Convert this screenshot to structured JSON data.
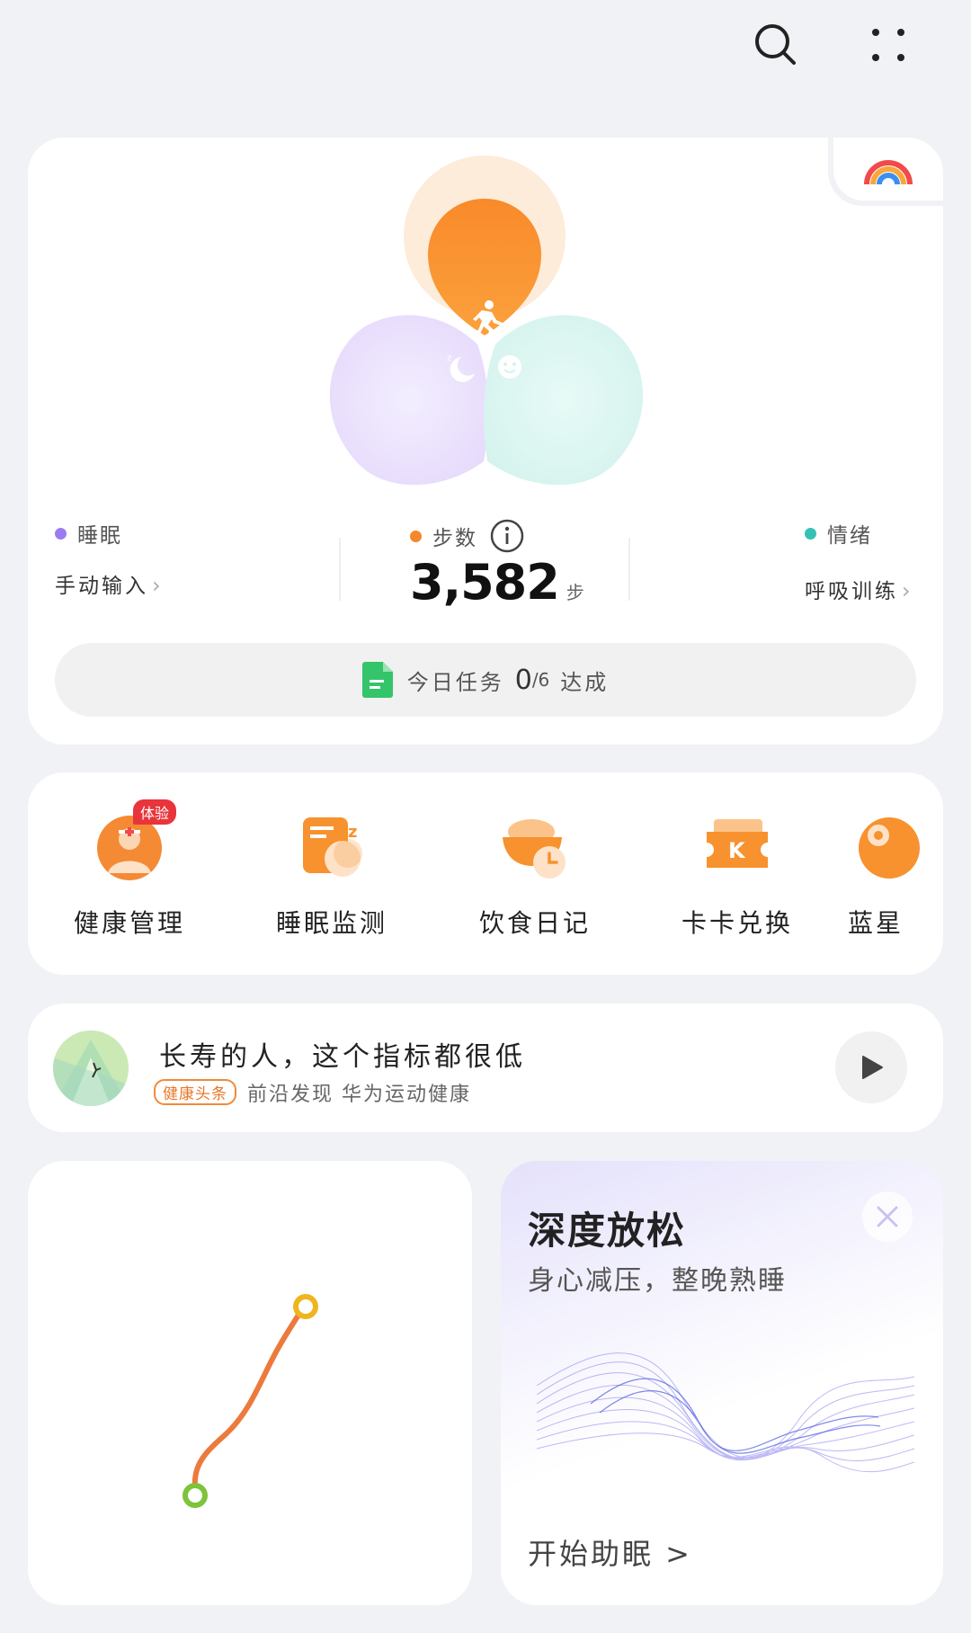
{
  "header": {
    "search_icon": "search-icon",
    "menu_icon": "more-dots-icon"
  },
  "rings": {
    "sleep": {
      "label": "睡眠",
      "link": "手动输入",
      "color": "#9b7cf0"
    },
    "steps": {
      "label": "步数",
      "value": "3,582",
      "unit": "步",
      "color": "#f5872b"
    },
    "mood": {
      "label": "情绪",
      "link": "呼吸训练",
      "color": "#35c1b5"
    },
    "tasks": {
      "prefix": "今日任务",
      "done": "0",
      "total": "/6",
      "suffix": "达成"
    }
  },
  "services": [
    {
      "label": "健康管理",
      "badge": "体验",
      "icon": "health-manager-icon"
    },
    {
      "label": "睡眠监测",
      "icon": "sleep-monitor-icon"
    },
    {
      "label": "饮食日记",
      "icon": "diet-diary-icon"
    },
    {
      "label": "卡卡兑换",
      "icon": "card-exchange-icon"
    },
    {
      "label": "蓝星",
      "icon": "blue-star-icon"
    }
  ],
  "news": {
    "title": "长寿的人，这个指标都很低",
    "tag": "健康头条",
    "source": "前沿发现 华为运动健康"
  },
  "relax": {
    "title": "深度放松",
    "subtitle": "身心减压，整晚熟睡",
    "cta": "开始助眠 >"
  },
  "colors": {
    "accent_orange": "#f5872b",
    "route": "#ec7a3c",
    "route_start": "#7dc43a",
    "route_end": "#f0b41e"
  }
}
